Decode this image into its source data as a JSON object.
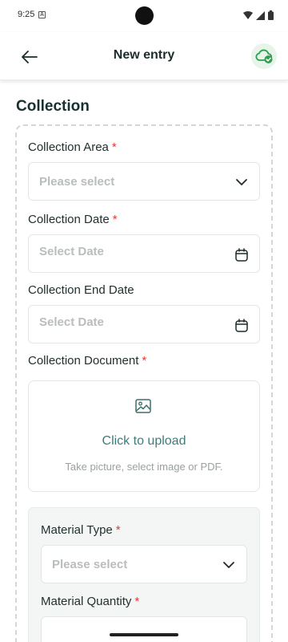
{
  "status_bar": {
    "time": "9:25",
    "notification_icon": "a-badge-icon",
    "icons": [
      "wifi-icon",
      "signal-icon",
      "battery-icon"
    ]
  },
  "app_bar": {
    "title": "New entry",
    "back_icon": "arrow-left-icon",
    "sync_icon": "cloud-check-icon",
    "sync_color": "#2e9e4f"
  },
  "section": {
    "title": "Collection"
  },
  "form": {
    "collection_area": {
      "label": "Collection Area",
      "required": "*",
      "placeholder": "Please select"
    },
    "collection_date": {
      "label": "Collection Date",
      "required": "*",
      "placeholder": "Select Date"
    },
    "collection_end_date": {
      "label": "Collection End Date",
      "placeholder": "Select Date"
    },
    "collection_document": {
      "label": "Collection Document",
      "required": "*",
      "upload_text": "Click to upload",
      "upload_hint": "Take picture, select image or PDF."
    },
    "material": {
      "type": {
        "label": "Material Type",
        "required": "*",
        "placeholder": "Please select"
      },
      "quantity": {
        "label": "Material Quantity",
        "required": "*"
      }
    }
  },
  "colors": {
    "accent": "#3d7c7a",
    "required": "#e53935",
    "placeholder": "#b9bdbd"
  }
}
